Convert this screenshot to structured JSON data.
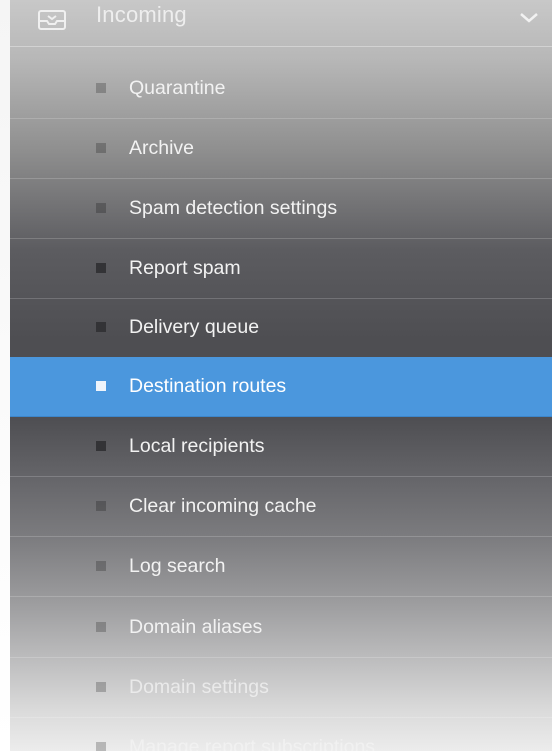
{
  "header": {
    "label": "Incoming",
    "icon": "inbox-icon",
    "toggle_icon": "chevron-down-icon"
  },
  "menu": {
    "items": [
      {
        "label": "Quarantine"
      },
      {
        "label": "Archive"
      },
      {
        "label": "Spam detection settings"
      },
      {
        "label": "Report spam"
      },
      {
        "label": "Delivery queue"
      },
      {
        "label": "Destination routes",
        "selected": true
      },
      {
        "label": "Local recipients"
      },
      {
        "label": "Clear incoming cache"
      },
      {
        "label": "Log search"
      },
      {
        "label": "Domain aliases"
      },
      {
        "label": "Domain settings"
      },
      {
        "label": "Manage report subscriptions"
      }
    ]
  },
  "colors": {
    "selected_background": "#4b97dd",
    "item_text": "#f2f2f2"
  }
}
